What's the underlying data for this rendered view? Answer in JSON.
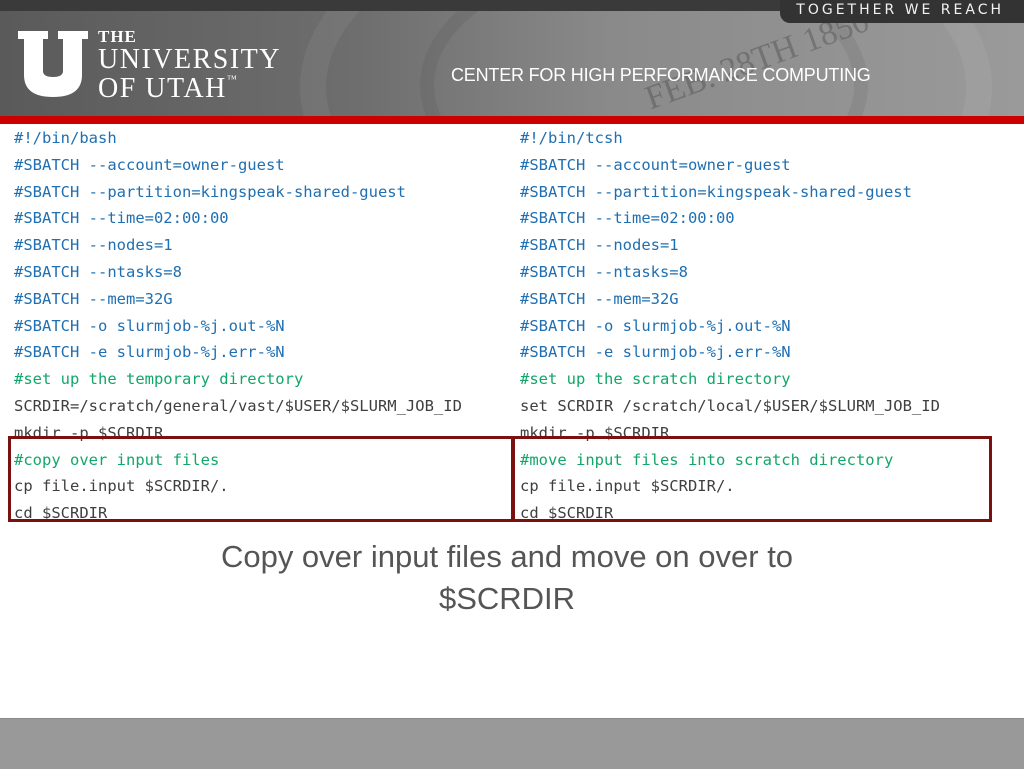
{
  "header": {
    "logo": {
      "line1": "THE",
      "line2": "UNIVERSITY",
      "line3": "OF UTAH",
      "trademark": "™"
    },
    "tagline": "TOGETHER WE REACH",
    "center_title": "CENTER FOR HIGH PERFORMANCE COMPUTING",
    "seal_text": "FEB. 28TH 1850"
  },
  "colors": {
    "accent_red": "#cc0000",
    "highlight_box": "#7a1010",
    "code_directive": "#1f6fb2",
    "code_comment": "#12a66a",
    "code_plain": "#3f3f3f"
  },
  "left_script": {
    "lines": [
      {
        "text": "#!/bin/bash",
        "kind": "directive"
      },
      {
        "text": "#SBATCH --account=owner-guest",
        "kind": "directive"
      },
      {
        "text": "#SBATCH --partition=kingspeak-shared-guest",
        "kind": "directive"
      },
      {
        "text": "#SBATCH --time=02:00:00",
        "kind": "directive"
      },
      {
        "text": "#SBATCH --nodes=1",
        "kind": "directive"
      },
      {
        "text": "#SBATCH --ntasks=8",
        "kind": "directive"
      },
      {
        "text": "#SBATCH --mem=32G",
        "kind": "directive"
      },
      {
        "text": "#SBATCH -o slurmjob-%j.out-%N",
        "kind": "directive"
      },
      {
        "text": "#SBATCH -e slurmjob-%j.err-%N",
        "kind": "directive"
      },
      {
        "text": "#set up the temporary directory",
        "kind": "comment"
      },
      {
        "text": "SCRDIR=/scratch/general/vast/$USER/$SLURM_JOB_ID",
        "kind": "plain"
      },
      {
        "text": "mkdir -p $SCRDIR",
        "kind": "plain"
      },
      {
        "text": "#copy over input files",
        "kind": "comment"
      },
      {
        "text": "cp file.input $SCRDIR/.",
        "kind": "plain"
      },
      {
        "text": "cd $SCRDIR",
        "kind": "plain"
      }
    ]
  },
  "right_script": {
    "lines": [
      {
        "text": "#!/bin/tcsh",
        "kind": "directive"
      },
      {
        "text": "#SBATCH --account=owner-guest",
        "kind": "directive"
      },
      {
        "text": "#SBATCH --partition=kingspeak-shared-guest",
        "kind": "directive"
      },
      {
        "text": "#SBATCH --time=02:00:00",
        "kind": "directive"
      },
      {
        "text": "#SBATCH --nodes=1",
        "kind": "directive"
      },
      {
        "text": "#SBATCH --ntasks=8",
        "kind": "directive"
      },
      {
        "text": "#SBATCH --mem=32G",
        "kind": "directive"
      },
      {
        "text": "#SBATCH -o slurmjob-%j.out-%N",
        "kind": "directive"
      },
      {
        "text": "#SBATCH -e slurmjob-%j.err-%N",
        "kind": "directive"
      },
      {
        "text": "#set up the scratch directory",
        "kind": "comment"
      },
      {
        "text": "set SCRDIR /scratch/local/$USER/$SLURM_JOB_ID",
        "kind": "plain"
      },
      {
        "text": "mkdir -p $SCRDIR",
        "kind": "plain"
      },
      {
        "text": "#move input files into scratch directory",
        "kind": "comment"
      },
      {
        "text": "cp file.input $SCRDIR/.",
        "kind": "plain"
      },
      {
        "text": "cd $SCRDIR",
        "kind": "plain"
      }
    ]
  },
  "caption": {
    "line1": "Copy over input files and move on over to",
    "line2": "$SCRDIR"
  }
}
